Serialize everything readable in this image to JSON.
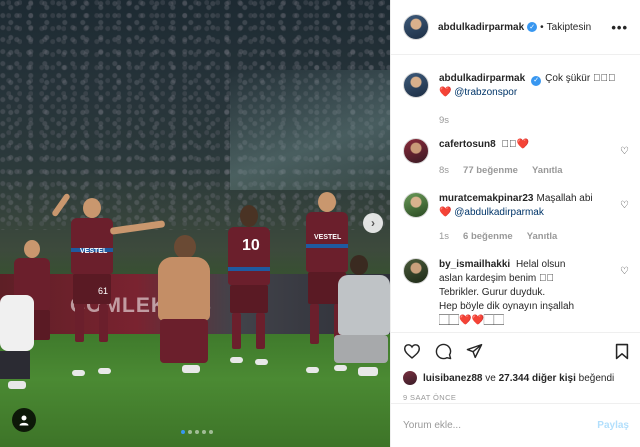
{
  "header": {
    "username": "abdulkadirparmak",
    "follow_status": "Takiptesin",
    "separator": "•"
  },
  "caption": {
    "username": "abdulkadirparmak",
    "text": "Çok şükür 🏻🏻🏻",
    "heart": "❤️",
    "mention": "@trabzonspor",
    "time": "9s"
  },
  "comments": [
    {
      "username": "cafertosun8",
      "text": "🏻🏻❤️",
      "time": "8s",
      "likes": "77 beğenme",
      "reply": "Yanıtla"
    },
    {
      "username": "muratcemakpinar23",
      "text": "Maşallah abi",
      "line2_heart": "❤️",
      "mention": "@abdulkadirparmak",
      "time": "1s",
      "likes": "6 beğenme",
      "reply": "Yanıtla"
    },
    {
      "username": "by_ismailhakki",
      "lines": [
        "Helal olsun",
        "aslan kardeşim benim 🏻🏻",
        "Tebrikler. Gurur duyduk.",
        "Hep böyle dik oynayın inşallah",
        "🏻🏻❤️❤️🏻🏻"
      ]
    }
  ],
  "likes": {
    "liker": "luisibanez88",
    "connector": "ve",
    "others": "27.344 diğer kişi",
    "suffix": "beğendi"
  },
  "time_ago": "9 SAAT ÖNCE",
  "comment_form": {
    "placeholder": "Yorum ekle...",
    "post_label": "Paylaş"
  },
  "photo": {
    "ad_text": "ÇOMLEKLAS",
    "shirt_text": "VESTEL",
    "player_numbers": [
      "61",
      "10"
    ]
  },
  "colors": {
    "link": "#003569",
    "verified": "#3897f0",
    "post_disabled": "#b2dffc",
    "meta": "#999999"
  },
  "icons": {
    "like": "heart-icon",
    "comment": "comment-icon",
    "share": "share-icon",
    "save": "bookmark-icon",
    "more": "more-icon",
    "tag": "user-tag-icon",
    "next": "chevron-right-icon"
  }
}
